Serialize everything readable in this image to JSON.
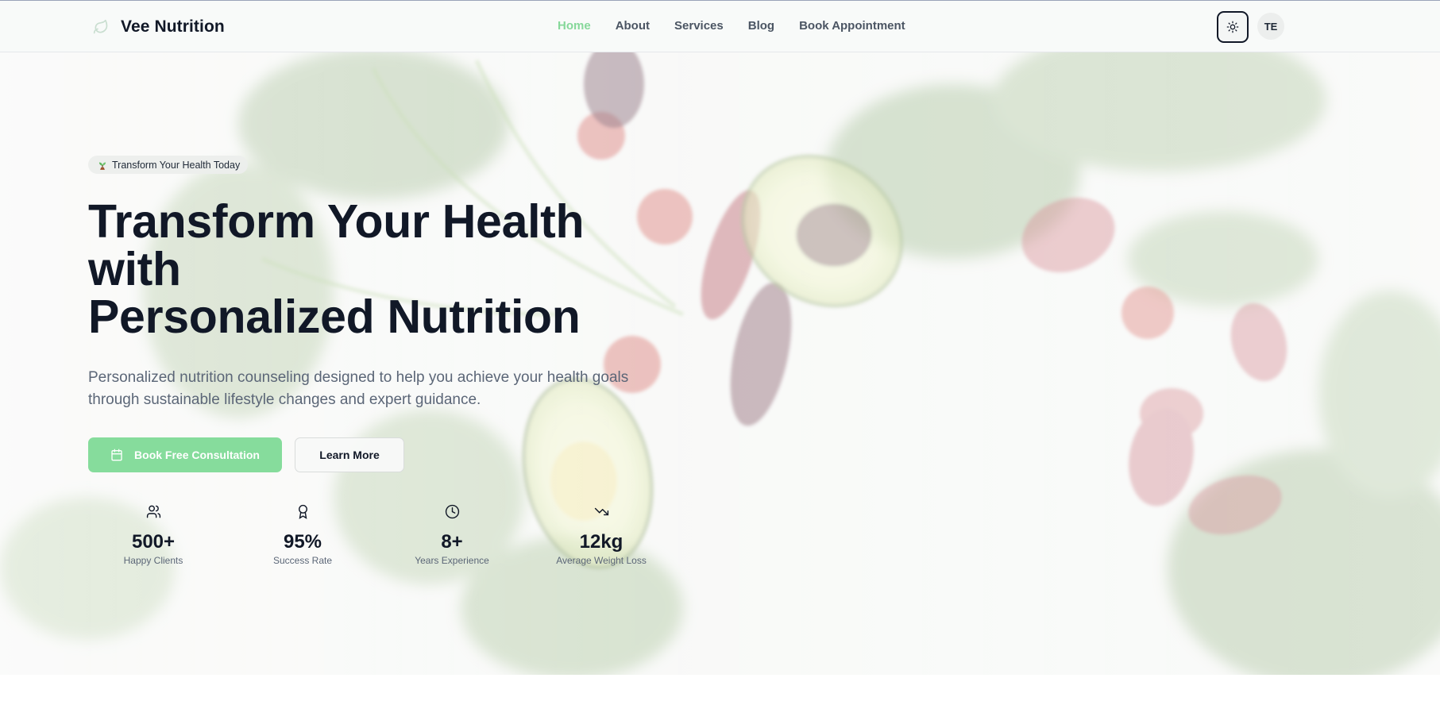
{
  "brand": {
    "name": "Vee Nutrition",
    "logo_icon": "leaf-icon"
  },
  "nav": {
    "items": [
      {
        "label": "Home",
        "active": true
      },
      {
        "label": "About",
        "active": false
      },
      {
        "label": "Services",
        "active": false
      },
      {
        "label": "Blog",
        "active": false
      },
      {
        "label": "Book Appointment",
        "active": false
      }
    ],
    "theme_toggle_icon": "sun-icon",
    "language": "TE"
  },
  "hero": {
    "badge_icon": "seedling-icon",
    "badge": "Transform Your Health Today",
    "title_lines": [
      "Transform Your Health",
      "with",
      "Personalized Nutrition"
    ],
    "subtitle": "Personalized nutrition counseling designed to help you achieve your health goals through sustainable lifestyle changes and expert guidance.",
    "primary_button": {
      "label": "Book Free Consultation",
      "icon": "calendar-icon"
    },
    "secondary_button": {
      "label": "Learn More"
    },
    "stats": [
      {
        "icon": "users-icon",
        "value": "500+",
        "label": "Happy Clients"
      },
      {
        "icon": "award-icon",
        "value": "95%",
        "label": "Success Rate"
      },
      {
        "icon": "clock-icon",
        "value": "8+",
        "label": "Years Experience"
      },
      {
        "icon": "trending-down-icon",
        "value": "12kg",
        "label": "Average Weight Loss"
      }
    ]
  },
  "colors": {
    "accent": "#86dc9c",
    "nav_active": "#86d89a",
    "heading": "#111827",
    "muted": "#5b6677"
  }
}
